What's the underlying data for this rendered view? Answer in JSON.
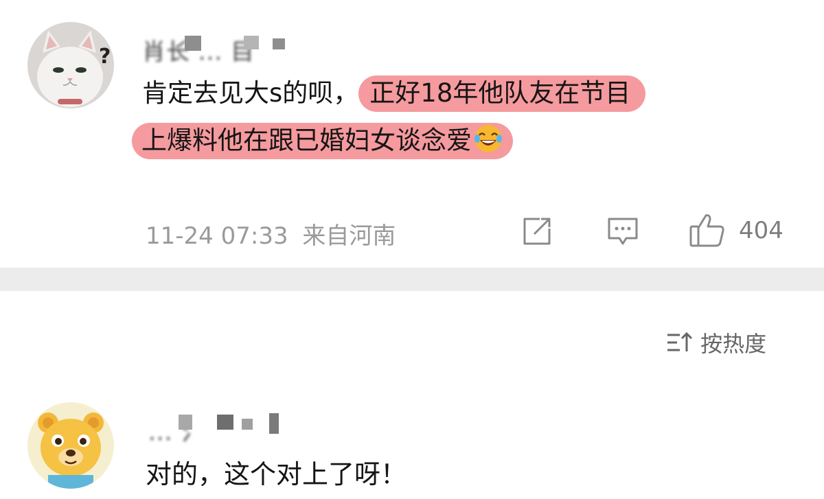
{
  "comments": [
    {
      "username": "肖长 ... 目",
      "text_plain": "肯定去见大s的呗，",
      "text_highlight_1": "正好18年他队友在节目",
      "text_highlight_2": "上爆料他在跟已婚妇女谈念爱",
      "emoji": "laughing-tears-emoji",
      "timestamp": "11-24 07:33",
      "location": "来自河南",
      "like_count": "404"
    },
    {
      "username": "... 氵",
      "text": "对的，这个对上了呀！"
    }
  ],
  "sort": {
    "label": "按热度"
  },
  "colors": {
    "highlight": "#f59a9e",
    "divider": "#ececec",
    "meta": "#9a9a9a"
  }
}
